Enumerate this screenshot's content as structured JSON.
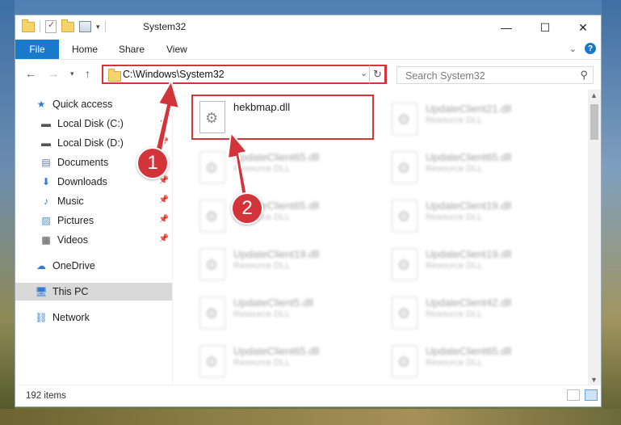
{
  "window": {
    "title": "System32",
    "controls": {
      "minimize": "—",
      "maximize": "☐",
      "close": "✕"
    }
  },
  "ribbon": {
    "file_tab": "File",
    "tabs": [
      "Home",
      "Share",
      "View"
    ]
  },
  "address": {
    "path": "C:\\Windows\\System32",
    "search_placeholder": "Search System32"
  },
  "nav_pane": {
    "items": [
      {
        "label": "Quick access",
        "icon": "star-icon",
        "pinned": false
      },
      {
        "label": "Local Disk (C:)",
        "icon": "drive-icon",
        "pinned": true
      },
      {
        "label": "Local Disk (D:)",
        "icon": "drive-icon",
        "pinned": true
      },
      {
        "label": "Documents",
        "icon": "documents-icon",
        "pinned": true
      },
      {
        "label": "Downloads",
        "icon": "download-icon",
        "pinned": true
      },
      {
        "label": "Music",
        "icon": "music-icon",
        "pinned": true
      },
      {
        "label": "Pictures",
        "icon": "pictures-icon",
        "pinned": true
      },
      {
        "label": "Videos",
        "icon": "videos-icon",
        "pinned": true
      },
      {
        "label": "OneDrive",
        "icon": "cloud-icon",
        "pinned": false
      },
      {
        "label": "This PC",
        "icon": "computer-icon",
        "pinned": false,
        "selected": true
      },
      {
        "label": "Network",
        "icon": "network-icon",
        "pinned": false
      }
    ]
  },
  "files": {
    "highlighted": {
      "name": "hekbmap.dll",
      "type": ""
    },
    "blurred_left": [
      {
        "name": "UpdateClient65.dll",
        "type": "Resource DLL"
      },
      {
        "name": "UpdateClient65.dll",
        "type": "Resource DLL"
      },
      {
        "name": "UpdateClient19.dll",
        "type": "Resource DLL"
      },
      {
        "name": "UpdateClient5.dll",
        "type": "Resource DLL"
      },
      {
        "name": "UpdateClient65.dll",
        "type": "Resource DLL"
      }
    ],
    "blurred_right": [
      {
        "name": "UpdateClient21.dll",
        "type": "Resource DLL"
      },
      {
        "name": "UpdateClient65.dll",
        "type": "Resource DLL"
      },
      {
        "name": "UpdateClient19.dll",
        "type": "Resource DLL"
      },
      {
        "name": "UpdateClient19.dll",
        "type": "Resource DLL"
      },
      {
        "name": "UpdateClient42.dll",
        "type": "Resource DLL"
      },
      {
        "name": "UpdateClient65.dll",
        "type": "Resource DLL"
      }
    ]
  },
  "status": {
    "item_count": "192 items"
  },
  "annotations": {
    "step1": "1",
    "step2": "2",
    "color": "#d3343a"
  }
}
